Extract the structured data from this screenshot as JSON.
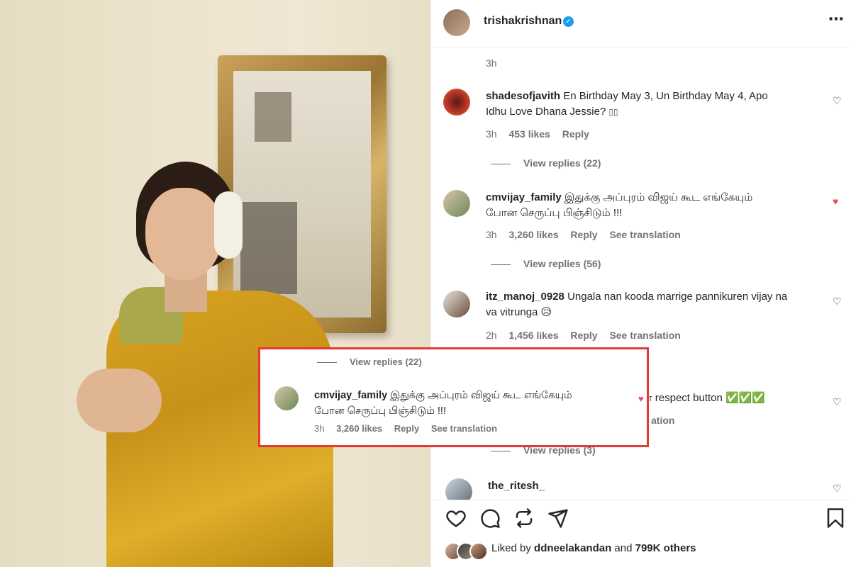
{
  "post": {
    "username": "trishakrishnan",
    "more_label": "⋯"
  },
  "comments": [
    {
      "time": "3h"
    },
    {
      "username": "shadesofjavith",
      "text_line1": "En Birthday May 3, Un Birthday May 4, Apo",
      "text_line2": "Idhu Love Dhana Jessie? ",
      "time": "3h",
      "likes": "453 likes",
      "reply": "Reply",
      "view_replies": "View replies (22)"
    },
    {
      "username": "cmvijay_family",
      "text_line1": "இதுக்கு அப்புரம் விஜய் கூட எங்கேயும்",
      "text_line2": "போன செருப்பு பிஞ்சிடும் !!!",
      "time": "3h",
      "likes": "3,260 likes",
      "reply": "Reply",
      "see_translation": "See translation",
      "view_replies": "View replies (56)"
    },
    {
      "username": "itz_manoj_0928",
      "text_line1": "Ungala nan kooda marrige pannikuren vijay na",
      "text_line2": "va vitrunga 😥",
      "time": "2h",
      "likes": "1,456 likes",
      "reply": "Reply",
      "see_translation": "See translation"
    },
    {
      "text_fragment": "தா respect button ✅✅✅",
      "translation_fragment": "ation",
      "view_replies_fragment": "View replies (3)"
    },
    {
      "username": "the_ritesh_"
    }
  ],
  "overlay": {
    "view_replies": "View replies (22)",
    "username": "cmvijay_family",
    "text_line1": "இதுக்கு அப்புரம் விஜய் கூட எங்கேயும்",
    "text_line2": "போன செருப்பு பிஞ்சிடும் !!!",
    "time": "3h",
    "likes": "3,260 likes",
    "reply": "Reply",
    "see_translation": "See translation"
  },
  "footer": {
    "liked_by_prefix": "Liked by",
    "liked_by_user": "ddneelakandan",
    "liked_by_and": "and",
    "liked_by_count": "799K others"
  },
  "icons": [
    "heart-icon",
    "comment-icon",
    "repost-icon",
    "share-icon",
    "bookmark-icon",
    "verified-icon",
    "more-icon"
  ],
  "colors": {
    "overlay_border": "#e53935",
    "liked_heart": "#ed4956",
    "verified": "#1d9bf0"
  }
}
